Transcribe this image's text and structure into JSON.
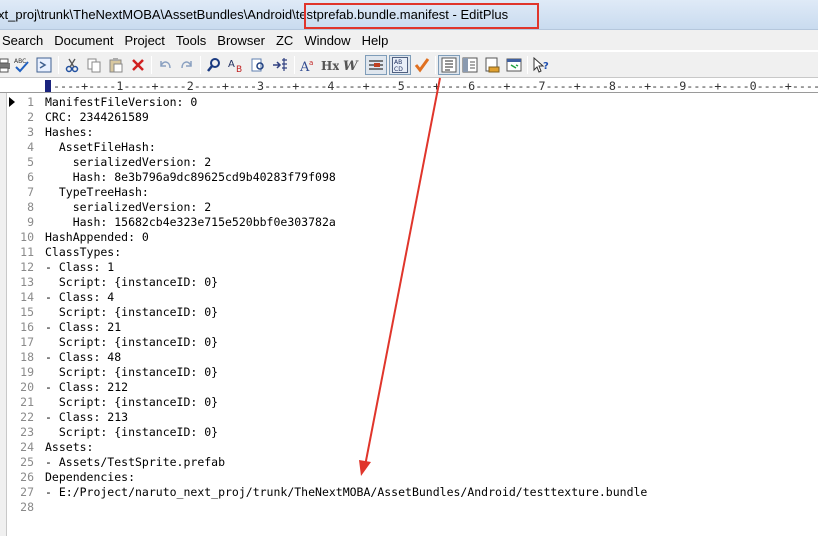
{
  "window": {
    "title_path": "xt_proj\\trunk\\TheNextMOBA\\AssetBundles\\Android\\",
    "title_file": "testprefab.bundle.manifest - EditPlus"
  },
  "menu": [
    "Search",
    "Document",
    "Project",
    "Tools",
    "Browser",
    "ZC",
    "Window",
    "Help"
  ],
  "toolbar_icons": [
    "print-icon",
    "spell-check-icon",
    "check-icon",
    "cut-icon",
    "copy-icon",
    "paste-icon",
    "delete-icon",
    "undo-icon",
    "redo-icon",
    "find-icon",
    "replace-icon",
    "find-in-files-icon",
    "goto-line-icon",
    "font-icon",
    "hex-icon",
    "word-wrap-icon",
    "ruler-icon",
    "abcd-icon",
    "checkmark-icon",
    "line-number-icon",
    "output-window-icon",
    "cliptext-icon",
    "browser-icon",
    "help-icon"
  ],
  "ruler": "----+----1----+----2----+----3----+----4----+----5----+----6----+----7----+----8----+----9----+----0----+----1-",
  "lines": [
    {
      "n": "1",
      "text": "ManifestFileVersion: 0"
    },
    {
      "n": "2",
      "text": "CRC: 2344261589"
    },
    {
      "n": "3",
      "text": "Hashes:"
    },
    {
      "n": "4",
      "text": "  AssetFileHash:"
    },
    {
      "n": "5",
      "text": "    serializedVersion: 2"
    },
    {
      "n": "6",
      "text": "    Hash: 8e3b796a9dc89625cd9b40283f79f098"
    },
    {
      "n": "7",
      "text": "  TypeTreeHash:"
    },
    {
      "n": "8",
      "text": "    serializedVersion: 2"
    },
    {
      "n": "9",
      "text": "    Hash: 15682cb4e323e715e520bbf0e303782a"
    },
    {
      "n": "10",
      "text": "HashAppended: 0"
    },
    {
      "n": "11",
      "text": "ClassTypes:"
    },
    {
      "n": "12",
      "text": "- Class: 1"
    },
    {
      "n": "13",
      "text": "  Script: {instanceID: 0}"
    },
    {
      "n": "14",
      "text": "- Class: 4"
    },
    {
      "n": "15",
      "text": "  Script: {instanceID: 0}"
    },
    {
      "n": "16",
      "text": "- Class: 21"
    },
    {
      "n": "17",
      "text": "  Script: {instanceID: 0}"
    },
    {
      "n": "18",
      "text": "- Class: 48"
    },
    {
      "n": "19",
      "text": "  Script: {instanceID: 0}"
    },
    {
      "n": "20",
      "text": "- Class: 212"
    },
    {
      "n": "21",
      "text": "  Script: {instanceID: 0}"
    },
    {
      "n": "22",
      "text": "- Class: 213"
    },
    {
      "n": "23",
      "text": "  Script: {instanceID: 0}"
    },
    {
      "n": "24",
      "text": "Assets:"
    },
    {
      "n": "25",
      "text": "- Assets/TestSprite.prefab"
    },
    {
      "n": "26",
      "text": "Dependencies:"
    },
    {
      "n": "27",
      "text": "- E:/Project/naruto_next_proj/trunk/TheNextMOBA/AssetBundles/Android/testtexture.bundle"
    },
    {
      "n": "28",
      "text": ""
    }
  ],
  "colors": {
    "highlight": "#e0352b",
    "line_number": "#8a8a8a"
  }
}
